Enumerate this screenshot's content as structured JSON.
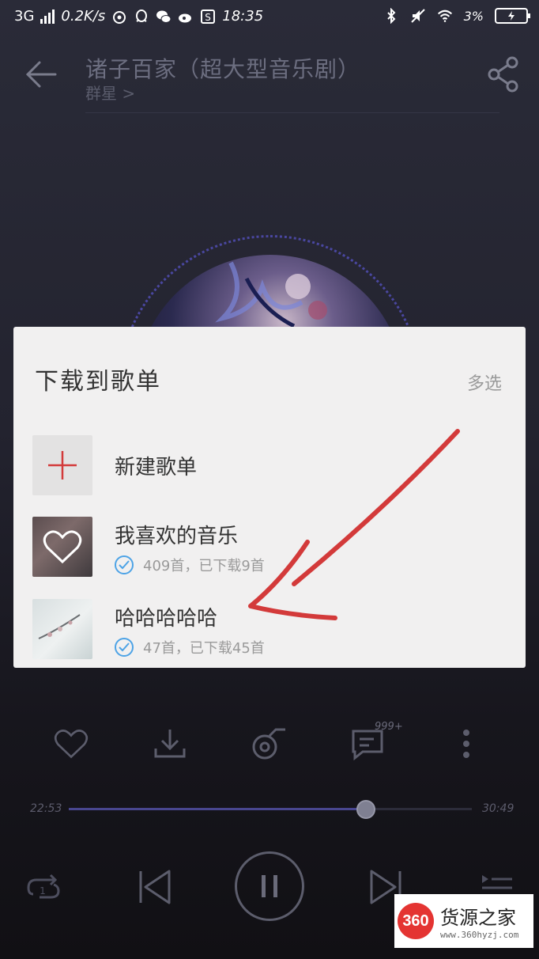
{
  "status_bar": {
    "network": "3G",
    "speed": "0.2K/s",
    "time": "18:35",
    "battery": "3%",
    "icons": [
      "signal-icon",
      "netease-icon",
      "qq-icon",
      "wechat-icon",
      "weibo-icon",
      "s-app-icon",
      "bluetooth-icon",
      "mute-icon",
      "wifi-icon",
      "battery-icon"
    ]
  },
  "header": {
    "title": "诸子百家（超大型音乐剧）",
    "artist": "群星 >",
    "icons": [
      "back-arrow-icon",
      "share-icon"
    ]
  },
  "dialog": {
    "title": "下载到歌单",
    "multi_select": "多选",
    "new_playlist_label": "新建歌单",
    "playlists": [
      {
        "name": "我喜欢的音乐",
        "meta": "409首，已下载9首"
      },
      {
        "name": "哈哈哈哈哈",
        "meta": "47首，已下载45首"
      }
    ]
  },
  "actions": {
    "icons": [
      "heart-icon",
      "download-icon",
      "ringtone-icon",
      "comment-icon",
      "more-icon"
    ],
    "comment_count": "999+"
  },
  "progress": {
    "elapsed": "22:53",
    "total": "30:49",
    "fraction": 0.737
  },
  "playback": {
    "icons": [
      "repeat-one-icon",
      "previous-icon",
      "pause-icon",
      "next-icon",
      "playlist-icon"
    ]
  },
  "watermark": {
    "logo": "360",
    "name": "货源之家",
    "url": "www.360hyzj.com"
  },
  "colors": {
    "background": "#23232f",
    "dialog_bg": "#f1f0f0",
    "accent_red": "#d33a3a",
    "check_blue": "#4da3e6",
    "progress_fill": "#48468e"
  }
}
